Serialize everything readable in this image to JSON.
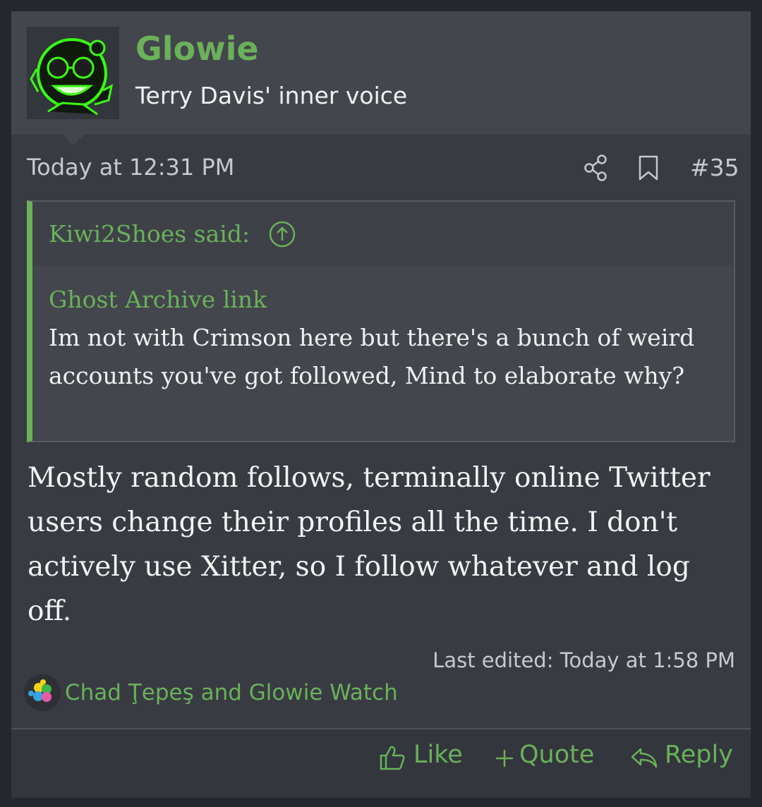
{
  "post": {
    "username": "Glowie",
    "user_title": "Terry Davis' inner voice",
    "date": "Today at 12:31 PM",
    "post_number": "#35",
    "quote": {
      "author_label": "Kiwi2Shoes said:",
      "link_text": "Ghost Archive link",
      "text": "Im not with Crimson here but there's a bunch of weird accounts you've got followed, Mind to elaborate why?"
    },
    "message": "Mostly random follows, terminally online Twitter users change their profiles all the time. I don't actively use Xitter, so I follow whatever and log off.",
    "last_edited": "Last edited: Today at 1:58 PM",
    "reactions": "Chad Ţepeş and Glowie Watch",
    "actions": {
      "like": "Like",
      "quote": "Quote",
      "reply": "Reply"
    }
  },
  "colors": {
    "accent": "#6ab15a",
    "background": "#383b42",
    "header": "#43464d"
  },
  "icons": [
    "share-icon",
    "bookmark-icon",
    "arrow-up-circle-icon",
    "thumbs-up-icon",
    "plus-icon",
    "reply-arrow-icon"
  ]
}
